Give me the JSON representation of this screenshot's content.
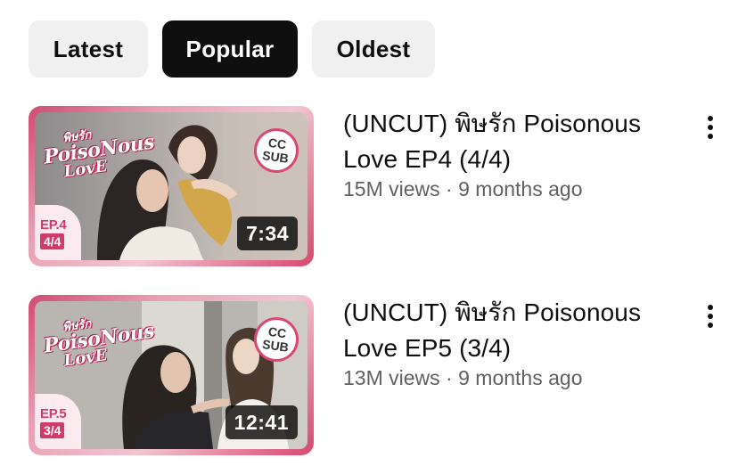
{
  "filter_chips": [
    {
      "label": "Latest",
      "selected": false
    },
    {
      "label": "Popular",
      "selected": true
    },
    {
      "label": "Oldest",
      "selected": false
    }
  ],
  "videos": [
    {
      "title_line1": "(UNCUT) พิษรัก Poisonous",
      "title_line2": "Love EP4 (4/4)",
      "views": "15M views",
      "separator": "·",
      "age": "9 months ago",
      "duration": "7:34",
      "thumbnail": {
        "logo_line1": "พิษรัก",
        "logo_line2": "PoisoNous",
        "logo_line3": "LovE",
        "cc_line1": "CC",
        "cc_line2": "SUB",
        "episode": "EP.4",
        "part": "4/4"
      }
    },
    {
      "title_line1": "(UNCUT) พิษรัก Poisonous",
      "title_line2": "Love EP5 (3/4)",
      "views": "13M views",
      "separator": "·",
      "age": "9 months ago",
      "duration": "12:41",
      "thumbnail": {
        "logo_line1": "พิษรัก",
        "logo_line2": "PoisoNous",
        "logo_line3": "LovE",
        "cc_line1": "CC",
        "cc_line2": "SUB",
        "episode": "EP.5",
        "part": "3/4"
      }
    }
  ],
  "icons": {
    "more": "vertical-ellipsis-icon"
  },
  "colors": {
    "chip_selected_bg": "#0f0f0f",
    "chip_bg": "#f0f0f0",
    "thumbnail_frame": "#d94873",
    "meta_text": "#606060"
  }
}
